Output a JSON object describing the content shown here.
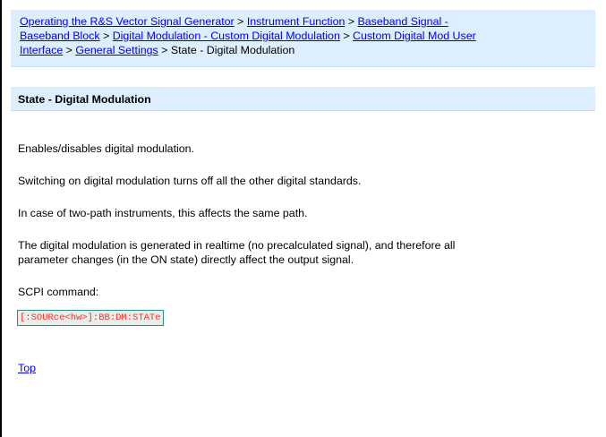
{
  "breadcrumb": {
    "links": [
      "Operating the R&S Vector Signal Generator",
      "Instrument Function",
      "Baseband Signal - Baseband Block",
      "Digital Modulation - Custom Digital Modulation",
      "Custom Digital Mod User Interface",
      "General Settings"
    ],
    "separator": ">",
    "current": "State - Digital Modulation",
    "line_segments": {
      "l1_a": "Operating the R&S Vector Signal Generator",
      "l1_b": "Instrument Function",
      "l1_c": "Baseband Signal -",
      "l2_a": "Baseband Block",
      "l2_b": "Digital Modulation - Custom Digital Modulation",
      "l2_c": "Custom Digital Mod User",
      "l3_a": "Interface",
      "l3_b": "General Settings"
    }
  },
  "heading": "State - Digital Modulation",
  "paragraphs": [
    "Enables/disables digital modulation.",
    "Switching on digital modulation turns off all the other digital standards.",
    "In case of two-path instruments, this affects the same path.",
    "The digital modulation is generated in realtime (no precalculated signal), and therefore all",
    "parameter changes (in the ON state) directly affect the output signal.",
    "SCPI command:"
  ],
  "scpi_command": "[:SOURce<hw>]:BB:DM:STATe",
  "top_link": "Top",
  "colors": {
    "panel_background": "#ddeefe",
    "link": "#0000ee",
    "code_text": "#ff2d2d",
    "code_border": "#2e8b87"
  }
}
